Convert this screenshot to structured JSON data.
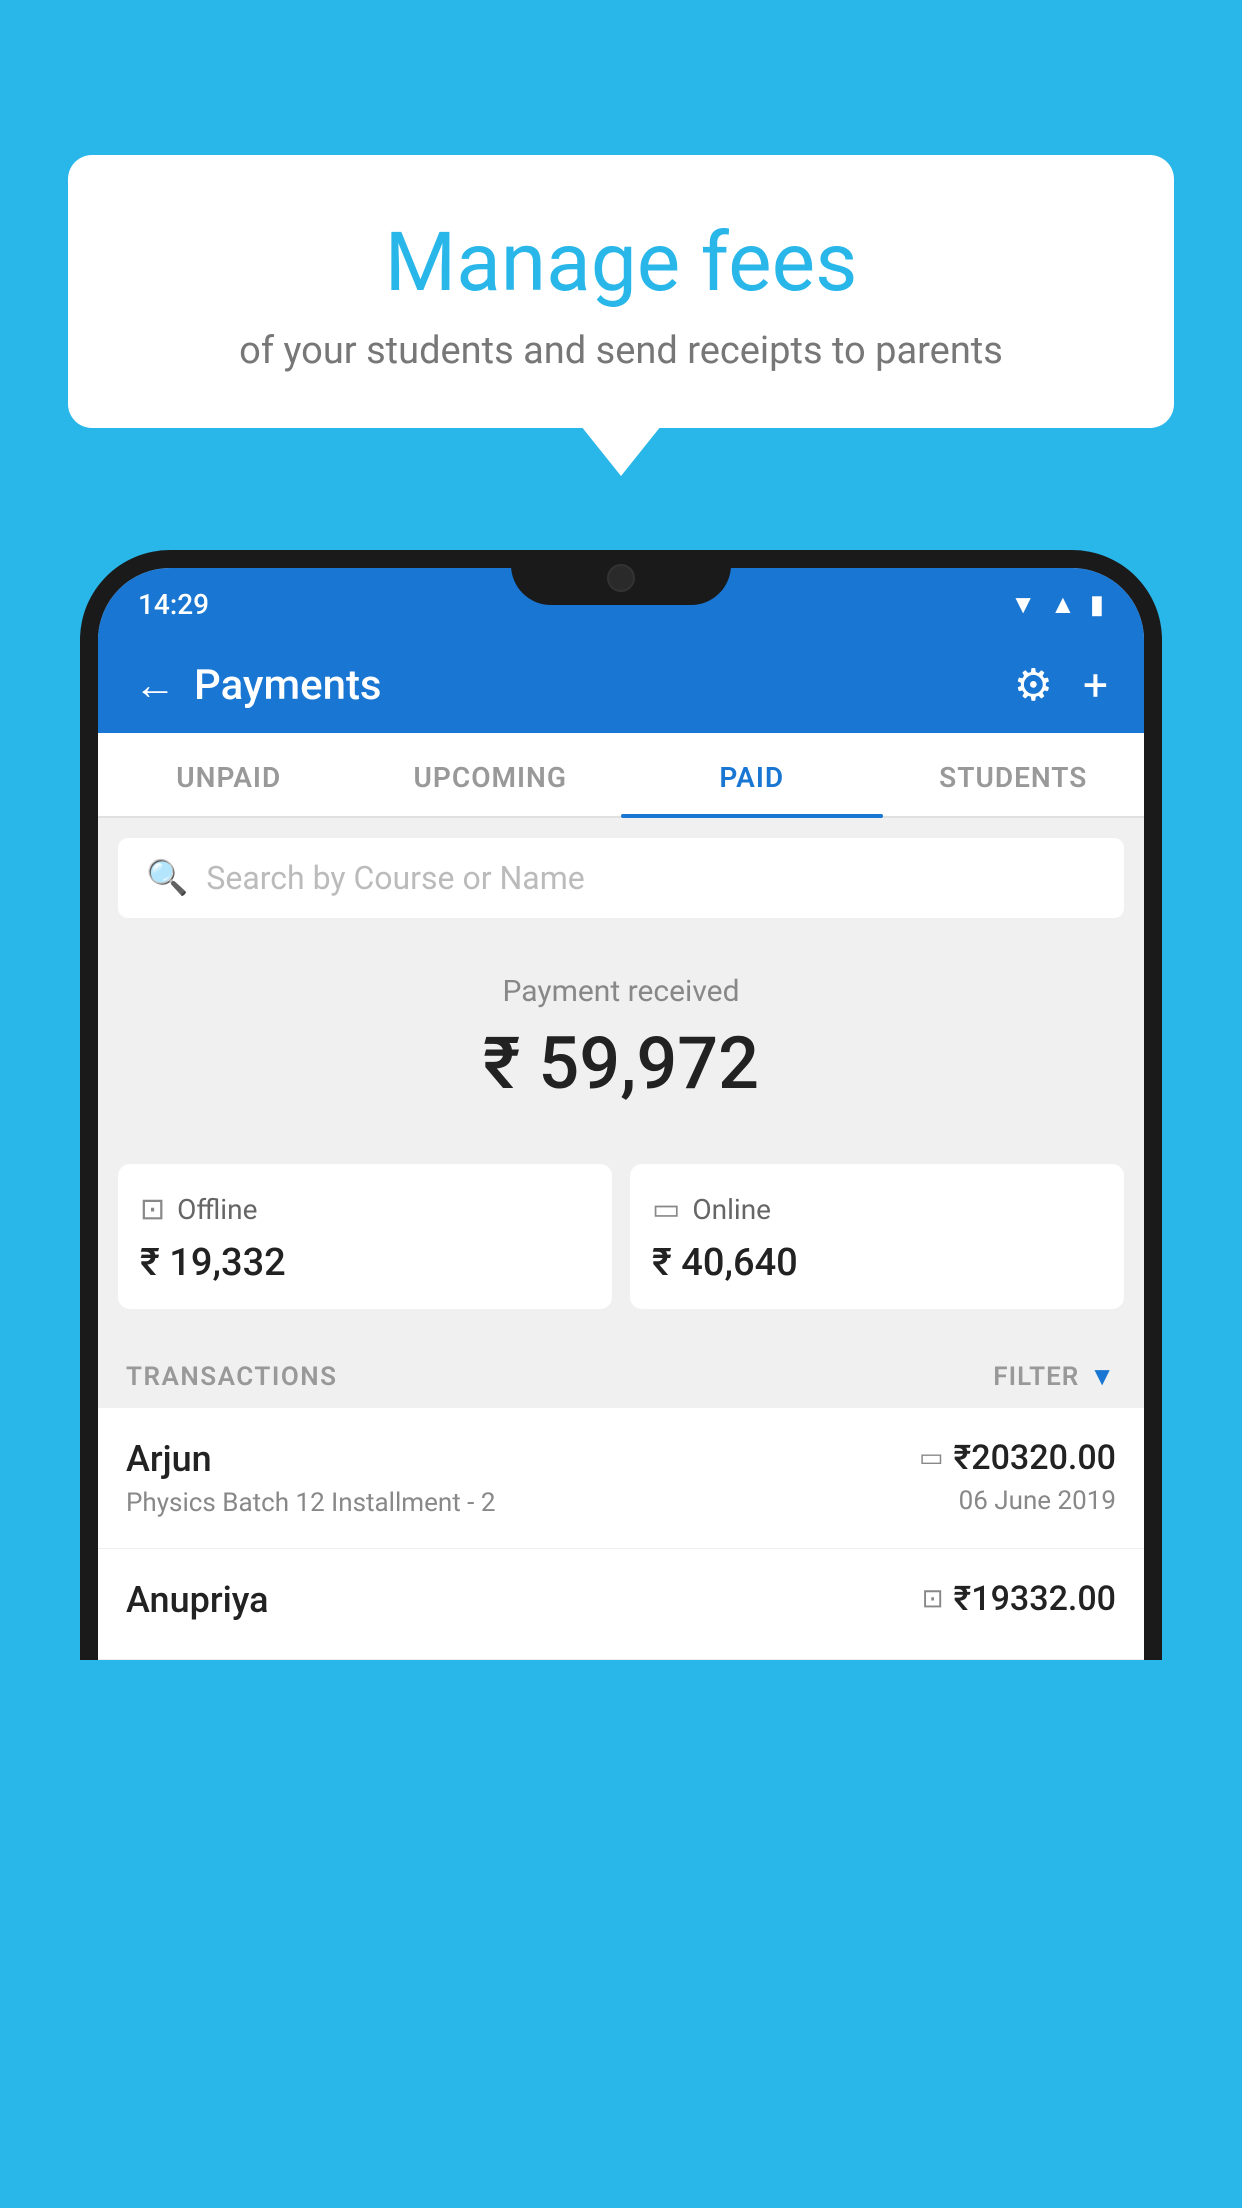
{
  "page": {
    "background_color": "#29b6e8"
  },
  "bubble": {
    "title": "Manage fees",
    "subtitle": "of your students and send receipts to parents"
  },
  "status_bar": {
    "time": "14:29"
  },
  "app_bar": {
    "title": "Payments"
  },
  "tabs": [
    {
      "id": "unpaid",
      "label": "UNPAID",
      "active": false
    },
    {
      "id": "upcoming",
      "label": "UPCOMING",
      "active": false
    },
    {
      "id": "paid",
      "label": "PAID",
      "active": true
    },
    {
      "id": "students",
      "label": "STUDENTS",
      "active": false
    }
  ],
  "search": {
    "placeholder": "Search by Course or Name"
  },
  "payment_summary": {
    "label": "Payment received",
    "total": "₹ 59,972",
    "offline_label": "Offline",
    "offline_amount": "₹ 19,332",
    "online_label": "Online",
    "online_amount": "₹ 40,640"
  },
  "transactions": {
    "header_label": "TRANSACTIONS",
    "filter_label": "FILTER",
    "rows": [
      {
        "name": "Arjun",
        "course": "Physics Batch 12 Installment - 2",
        "amount": "₹20320.00",
        "date": "06 June 2019",
        "payment_type": "online"
      },
      {
        "name": "Anupriya",
        "course": "",
        "amount": "₹19332.00",
        "date": "",
        "payment_type": "offline"
      }
    ]
  }
}
